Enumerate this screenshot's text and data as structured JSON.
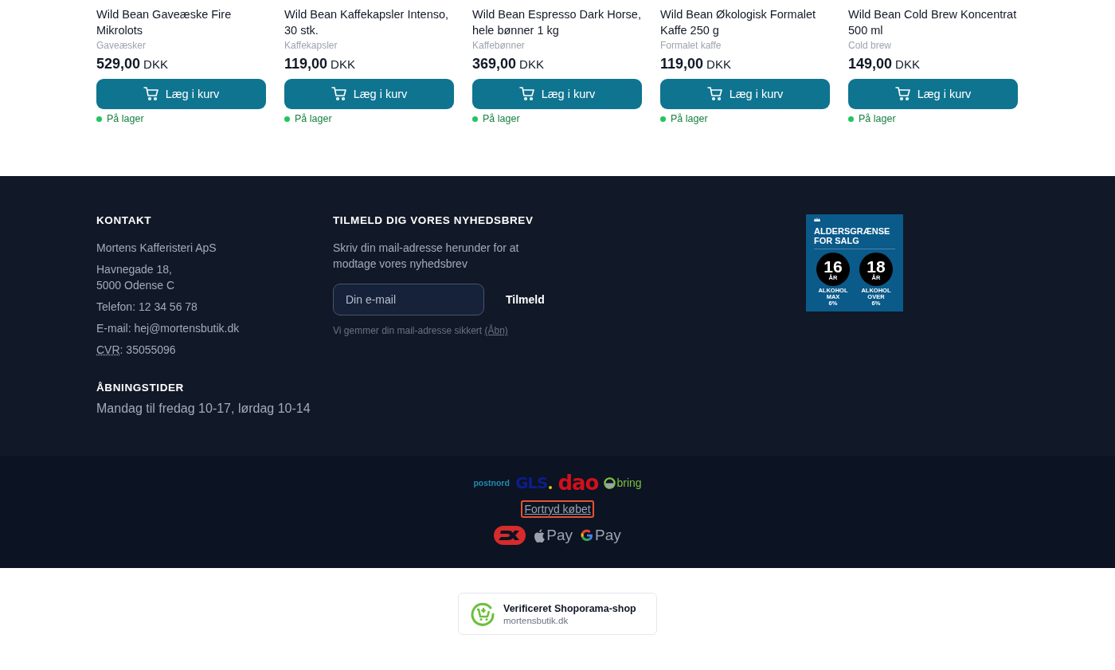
{
  "products": [
    {
      "name": "Wild Bean Gaveæske Fire Mikrolots",
      "category": "Gaveæsker",
      "price": "529,00",
      "currency": "DKK",
      "button": "Læg i kurv",
      "stock": "På lager",
      "in_stock": true
    },
    {
      "name": "Wild Bean Kaffekapsler Intenso, 30 stk.",
      "category": "Kaffekapsler",
      "price": "119,00",
      "currency": "DKK",
      "button": "Læg i kurv",
      "stock": "På lager",
      "in_stock": true
    },
    {
      "name": "Wild Bean Espresso Dark Horse, hele bønner 1 kg",
      "category": "Kaffebønner",
      "price": "369,00",
      "currency": "DKK",
      "button": "Læg i kurv",
      "stock": "På lager",
      "in_stock": true
    },
    {
      "name": "Wild Bean Økologisk Formalet Kaffe 250 g",
      "category": "Formalet kaffe",
      "price": "119,00",
      "currency": "DKK",
      "button": "Læg i kurv",
      "stock": "På lager",
      "in_stock": true
    },
    {
      "name": "Wild Bean Cold Brew Koncentrat 500 ml",
      "category": "Cold brew",
      "price": "149,00",
      "currency": "DKK",
      "button": "Læg i kurv",
      "stock": "På lager",
      "in_stock": true
    }
  ],
  "contact": {
    "heading": "KONTAKT",
    "company": "Mortens Kafferisteri ApS",
    "address": [
      "Havnegade 18,",
      "5000 Odense C"
    ],
    "phone": "Telefon: 12 34 56 78",
    "email": "E-mail: hej@mortensbutik.dk",
    "cvr_label": "CVR",
    "cvr_value": ": 35055096"
  },
  "hours": {
    "heading": "ÅBNINGSTIDER",
    "text": "Mandag til fredag 10-17, lørdag 10-14"
  },
  "newsletter": {
    "heading": "TILMELD DIG VORES NYHEDSBREV",
    "text": "Skriv din mail-adresse herunder for at modtage vores nyhedsbrev",
    "placeholder": "Din e-mail",
    "button": "Tilmeld",
    "note": "Vi gemmer din mail-adresse sikkert",
    "note_link": "(Åbn)"
  },
  "age_badge": {
    "title": [
      "ALDERSGRÆNSE",
      "FOR SALG"
    ],
    "limits": [
      {
        "age": "16",
        "unit": "ÅR",
        "label": [
          "ALKOHOL",
          "MAX",
          "6%"
        ]
      },
      {
        "age": "18",
        "unit": "ÅR",
        "label": [
          "ALKOHOL",
          "OVER",
          "6%"
        ]
      }
    ]
  },
  "carriers": [
    {
      "kind": "postnord",
      "name": "postnord"
    },
    {
      "kind": "gls",
      "name": "GLS"
    },
    {
      "kind": "dao",
      "name": "dao"
    },
    {
      "kind": "bring",
      "name": "bring"
    }
  ],
  "withdraw_link": {
    "label": "Fortryd købet",
    "focused": true
  },
  "payments": [
    {
      "kind": "dankort"
    },
    {
      "kind": "apple",
      "label": "Pay"
    },
    {
      "kind": "google",
      "label": "Pay"
    }
  ],
  "verified": {
    "title": "Verificeret Shoporama-shop",
    "domain": "mortensbutik.dk"
  }
}
